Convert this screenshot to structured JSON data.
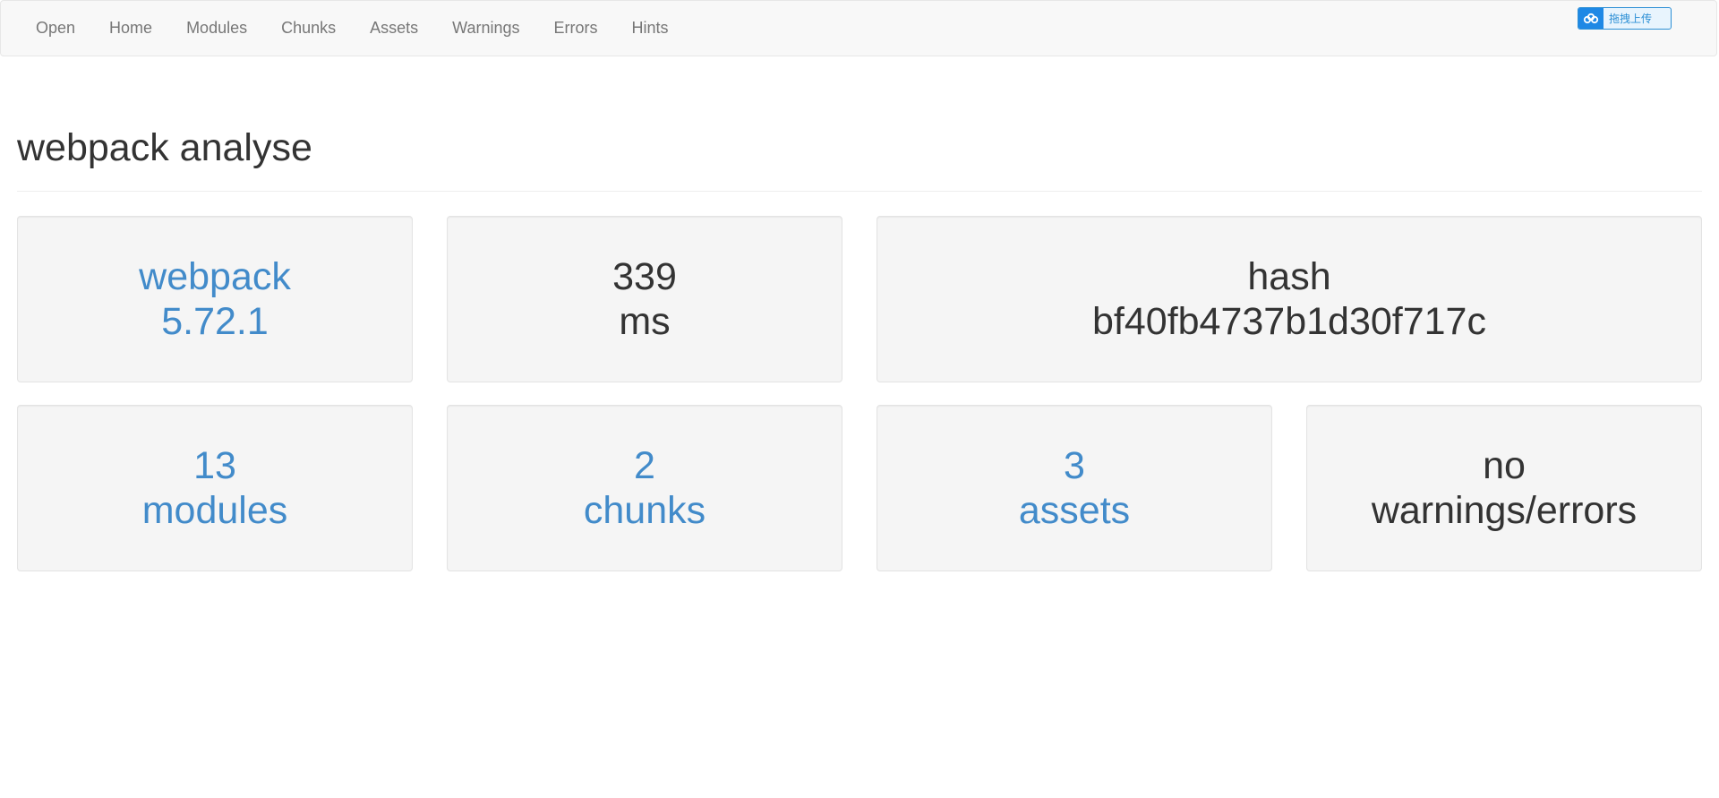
{
  "nav": {
    "items": [
      {
        "label": "Open"
      },
      {
        "label": "Home"
      },
      {
        "label": "Modules"
      },
      {
        "label": "Chunks"
      },
      {
        "label": "Assets"
      },
      {
        "label": "Warnings"
      },
      {
        "label": "Errors"
      },
      {
        "label": "Hints"
      }
    ]
  },
  "upload_widget": {
    "label": "拖拽上传",
    "icon": "cloud-icon"
  },
  "page": {
    "title": "webpack analyse"
  },
  "cards": {
    "webpack": {
      "line1": "webpack",
      "line2": "5.72.1"
    },
    "time": {
      "line1": "339",
      "line2": "ms"
    },
    "hash": {
      "line1": "hash",
      "line2": "bf40fb4737b1d30f717c"
    },
    "modules": {
      "line1": "13",
      "line2": "modules"
    },
    "chunks": {
      "line1": "2",
      "line2": "chunks"
    },
    "assets": {
      "line1": "3",
      "line2": "assets"
    },
    "problems": {
      "line1": "no",
      "line2": "warnings/errors"
    }
  },
  "colors": {
    "link": "#428bca",
    "text": "#333333",
    "nav_text": "#777777",
    "card_bg": "#f5f5f5",
    "navbar_bg": "#f8f8f8"
  }
}
